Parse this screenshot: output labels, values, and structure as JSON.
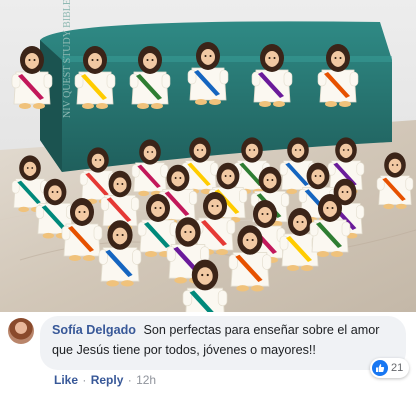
{
  "comment": {
    "author": "Sofía Delgado",
    "text": "Son perfectas para enseñar sobre el amor que Jesús tiene por todos, jóvenes o mayores!!",
    "reaction_count": "21",
    "reaction_icon": "like-thumb-icon",
    "actions": {
      "like": "Like",
      "separator": "·",
      "reply": "Reply",
      "time": "12h"
    }
  },
  "photo": {
    "book_spine_text": "NIV QUEST STUDY BIBLE",
    "book_color": "#2c7c78",
    "figure_sash_colors": [
      "#c2185b",
      "#ffcc00",
      "#2e7d32",
      "#1565c0",
      "#6a1b9a",
      "#e65100",
      "#00897b",
      "#e53935"
    ]
  },
  "colors": {
    "link": "#385898",
    "bubble": "#f0f2f5",
    "muted": "#90949c",
    "like_blue": "#1877f2"
  }
}
